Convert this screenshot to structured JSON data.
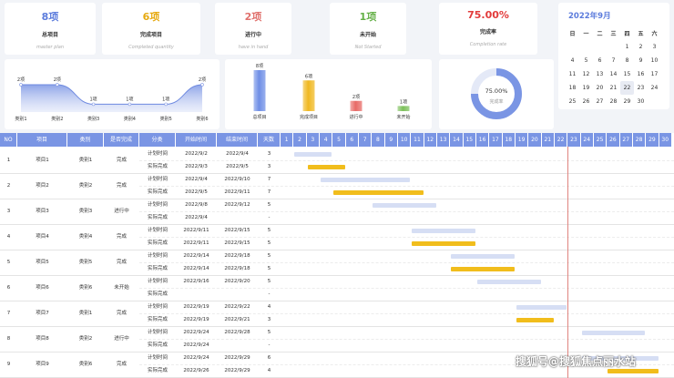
{
  "kpis": [
    {
      "value": "8项",
      "title": "总项目",
      "sub": "master plan",
      "color": "#5b7bdc"
    },
    {
      "value": "6项",
      "title": "完成项目",
      "sub": "Completed quantity",
      "color": "#e6a90f"
    },
    {
      "value": "2项",
      "title": "进行中",
      "sub": "have in hand",
      "color": "#e0706c"
    },
    {
      "value": "1项",
      "title": "未开始",
      "sub": "Not Started",
      "color": "#64b047"
    },
    {
      "value": "75.00%",
      "title": "完成率",
      "sub": "Completion rate",
      "color": "#e23b3b"
    }
  ],
  "calendar": {
    "title": "2022年9月",
    "weekdays": [
      "日",
      "一",
      "二",
      "三",
      "四",
      "五",
      "六"
    ],
    "weeks": [
      [
        "",
        "",
        "",
        "",
        "1",
        "2",
        "3"
      ],
      [
        "4",
        "5",
        "6",
        "7",
        "8",
        "9",
        "10"
      ],
      [
        "11",
        "12",
        "13",
        "14",
        "15",
        "16",
        "17"
      ],
      [
        "18",
        "19",
        "20",
        "21",
        "22",
        "23",
        "24"
      ],
      [
        "25",
        "26",
        "27",
        "28",
        "29",
        "30",
        ""
      ]
    ],
    "today": "22"
  },
  "chart_data": [
    {
      "type": "area",
      "categories": [
        "类别1",
        "类别2",
        "类别3",
        "类别4",
        "类别5",
        "类别6"
      ],
      "values": [
        2,
        2,
        1,
        1,
        1,
        2
      ],
      "data_labels": [
        "2项",
        "2项",
        "1项",
        "1项",
        "1项",
        "2项"
      ],
      "color": "#7a95e4"
    },
    {
      "type": "bar",
      "categories": [
        "总项目",
        "完成项目",
        "进行中",
        "未开始"
      ],
      "values": [
        8,
        6,
        2,
        1
      ],
      "data_labels": [
        "8项",
        "6项",
        "2项",
        "1项"
      ],
      "colors": [
        "#6f8fe6",
        "#f0b820",
        "#e86a66",
        "#7cc05a"
      ]
    },
    {
      "type": "pie",
      "values": [
        75,
        25
      ],
      "center_value": "75.00%",
      "center_label": "完成率",
      "colors": [
        "#7a95e4",
        "#e4e9f7"
      ]
    }
  ],
  "gantt": {
    "headers": [
      "NO",
      "项目",
      "类别",
      "是否完成",
      "分类",
      "开始时间",
      "结束时间",
      "天数"
    ],
    "days": [
      "1",
      "2",
      "3",
      "4",
      "5",
      "6",
      "7",
      "8",
      "9",
      "10",
      "11",
      "12",
      "13",
      "14",
      "15",
      "16",
      "17",
      "18",
      "19",
      "20",
      "21",
      "22",
      "23",
      "24",
      "25",
      "26",
      "27",
      "28",
      "29",
      "30"
    ],
    "today_day": 22,
    "rows": [
      {
        "no": "1",
        "project": "项目1",
        "category": "类别1",
        "status": "完成",
        "plan": {
          "label": "计划时间",
          "start": "2022/9/2",
          "end": "2022/9/4",
          "days": "3",
          "s": 2,
          "e": 4
        },
        "actual": {
          "label": "实际完成",
          "start": "2022/9/3",
          "end": "2022/9/5",
          "days": "3",
          "s": 3,
          "e": 5
        }
      },
      {
        "no": "2",
        "project": "项目2",
        "category": "类别2",
        "status": "完成",
        "plan": {
          "label": "计划时间",
          "start": "2022/9/4",
          "end": "2022/9/10",
          "days": "7",
          "s": 4,
          "e": 10
        },
        "actual": {
          "label": "实际完成",
          "start": "2022/9/5",
          "end": "2022/9/11",
          "days": "7",
          "s": 5,
          "e": 11
        }
      },
      {
        "no": "3",
        "project": "项目3",
        "category": "类别3",
        "status": "进行中",
        "plan": {
          "label": "计划时间",
          "start": "2022/9/8",
          "end": "2022/9/12",
          "days": "5",
          "s": 8,
          "e": 12
        },
        "actual": {
          "label": "实际完成",
          "start": "2022/9/4",
          "end": "",
          "days": "-",
          "s": null,
          "e": null
        }
      },
      {
        "no": "4",
        "project": "项目4",
        "category": "类别4",
        "status": "完成",
        "plan": {
          "label": "计划时间",
          "start": "2022/9/11",
          "end": "2022/9/15",
          "days": "5",
          "s": 11,
          "e": 15
        },
        "actual": {
          "label": "实际完成",
          "start": "2022/9/11",
          "end": "2022/9/15",
          "days": "5",
          "s": 11,
          "e": 15
        }
      },
      {
        "no": "5",
        "project": "项目5",
        "category": "类别5",
        "status": "完成",
        "plan": {
          "label": "计划时间",
          "start": "2022/9/14",
          "end": "2022/9/18",
          "days": "5",
          "s": 14,
          "e": 18
        },
        "actual": {
          "label": "实际完成",
          "start": "2022/9/14",
          "end": "2022/9/18",
          "days": "5",
          "s": 14,
          "e": 18
        }
      },
      {
        "no": "6",
        "project": "项目6",
        "category": "类别6",
        "status": "未开始",
        "plan": {
          "label": "计划时间",
          "start": "2022/9/16",
          "end": "2022/9/20",
          "days": "5",
          "s": 16,
          "e": 20
        },
        "actual": {
          "label": "实际完成",
          "start": "",
          "end": "",
          "days": "-",
          "s": null,
          "e": null
        }
      },
      {
        "no": "7",
        "project": "项目7",
        "category": "类别1",
        "status": "完成",
        "plan": {
          "label": "计划时间",
          "start": "2022/9/19",
          "end": "2022/9/22",
          "days": "4",
          "s": 19,
          "e": 22
        },
        "actual": {
          "label": "实际完成",
          "start": "2022/9/19",
          "end": "2022/9/21",
          "days": "3",
          "s": 19,
          "e": 21
        }
      },
      {
        "no": "8",
        "project": "项目8",
        "category": "类别2",
        "status": "进行中",
        "plan": {
          "label": "计划时间",
          "start": "2022/9/24",
          "end": "2022/9/28",
          "days": "5",
          "s": 24,
          "e": 28
        },
        "actual": {
          "label": "实际完成",
          "start": "2022/9/24",
          "end": "",
          "days": "-",
          "s": null,
          "e": null
        }
      },
      {
        "no": "9",
        "project": "项目9",
        "category": "类别6",
        "status": "完成",
        "plan": {
          "label": "计划时间",
          "start": "2022/9/24",
          "end": "2022/9/29",
          "days": "6",
          "s": 24,
          "e": 29
        },
        "actual": {
          "label": "实际完成",
          "start": "2022/9/26",
          "end": "2022/9/29",
          "days": "4",
          "s": 26,
          "e": 29
        }
      }
    ]
  },
  "watermark": "搜狐号@搜狐焦点丽水站"
}
